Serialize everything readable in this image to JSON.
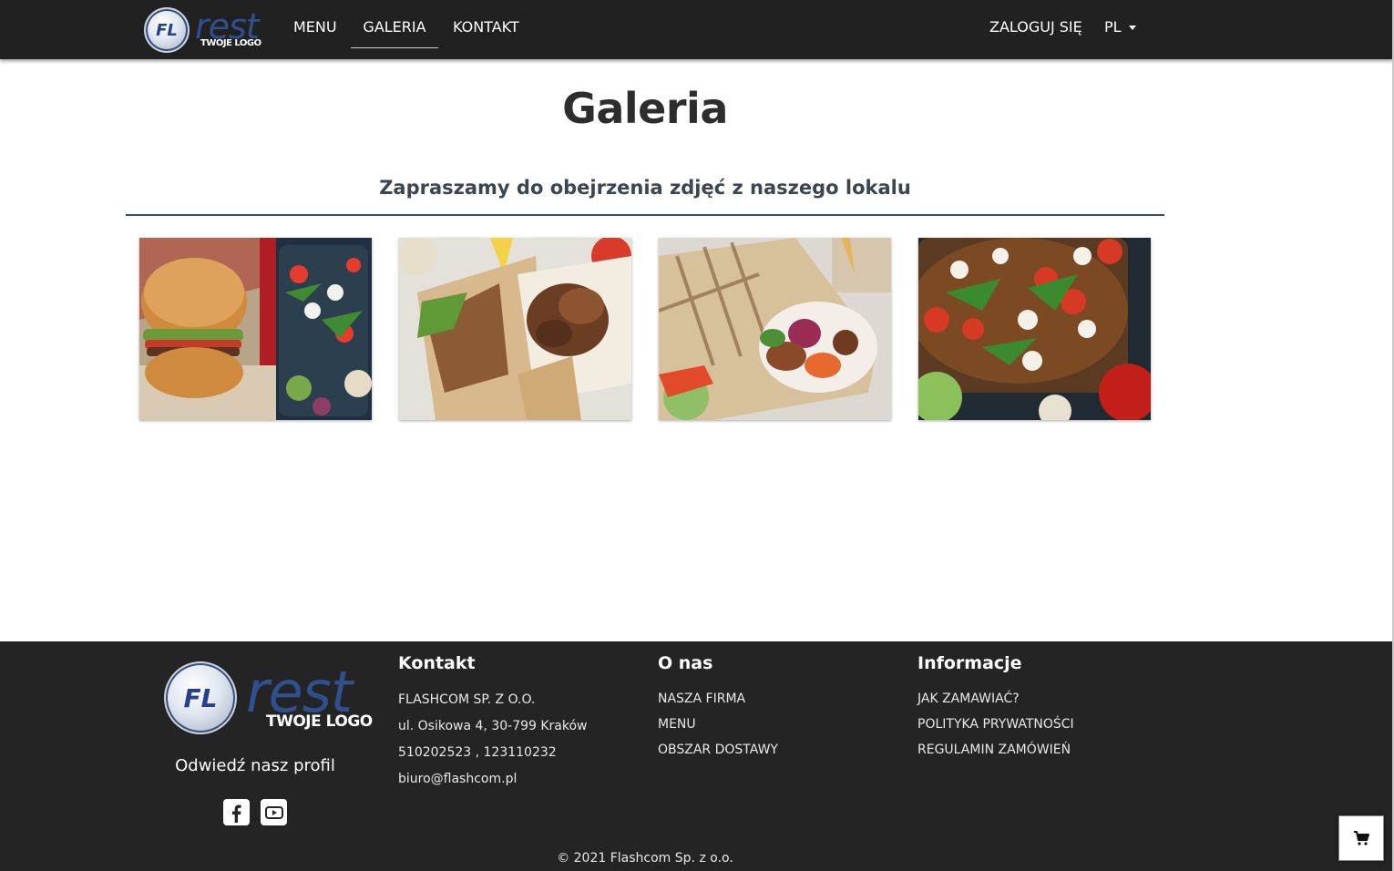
{
  "brand": {
    "logo_initials": "FL",
    "logo_word": "rest",
    "logo_tagline": "TWOJE LOGO"
  },
  "nav": {
    "menu": "MENU",
    "galeria": "GALERIA",
    "kontakt": "KONTAKT",
    "login": "ZALOGUJ SIĘ",
    "language": "PL",
    "active": "GALERIA"
  },
  "main": {
    "title": "Galeria",
    "subtitle": "Zapraszamy do obejrzenia zdjęć z naszego lokalu",
    "gallery": [
      {
        "subject": "burger-and-salad-photo"
      },
      {
        "subject": "grilled-chicken-wrap-photo"
      },
      {
        "subject": "tortilla-wrap-photo"
      },
      {
        "subject": "salad-bowl-photo"
      }
    ]
  },
  "footer": {
    "profile_label": "Odwiedź nasz profil",
    "social": [
      "facebook-icon",
      "youtube-icon"
    ],
    "contact": {
      "heading": "Kontakt",
      "company": "FLASHCOM SP. Z O.O.",
      "address": "ul. Osikowa 4, 30-799 Kraków",
      "phones": "510202523 , 123110232",
      "email": "biuro@flashcom.pl"
    },
    "about": {
      "heading": "O nas",
      "links": [
        "NASZA FIRMA",
        "MENU",
        "OBSZAR DOSTAWY"
      ]
    },
    "info": {
      "heading": "Informacje",
      "links": [
        "JAK ZAMAWIAĆ?",
        "POLITYKA PRYWATNOŚCI",
        "REGULAMIN ZAMÓWIEŃ"
      ]
    },
    "copyright": "© 2021 Flashcom Sp. z o.o."
  },
  "colors": {
    "navbar": "#212121",
    "footer": "#242424",
    "accent_rule": "#2d5365",
    "logo_blue": "#2f4f8f"
  }
}
